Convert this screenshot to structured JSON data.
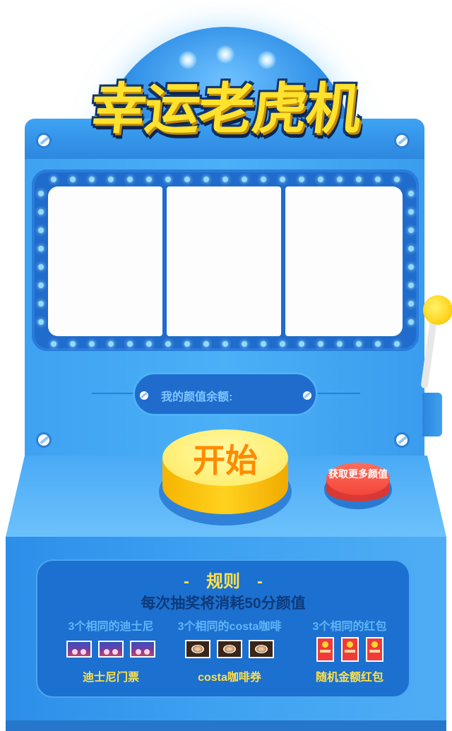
{
  "title": "幸运老虎机",
  "balance": {
    "label": "我的颜值余额:",
    "value": ""
  },
  "buttons": {
    "start": "开始",
    "more": "获取更多颜值"
  },
  "rules": {
    "title": "-　规则　-",
    "description": "每次抽奖将消耗50分颜值",
    "prizes": [
      {
        "condition": "3个相同的迪士尼",
        "reward": "迪士尼门票",
        "icon": "disney-ticket-icon"
      },
      {
        "condition": "3个相同的costa咖啡",
        "reward": "costa咖啡券",
        "icon": "coffee-icon"
      },
      {
        "condition": "3个相同的红包",
        "reward": "随机金额红包",
        "icon": "red-packet-icon"
      }
    ]
  },
  "colors": {
    "cabinet": "#3ea2f2",
    "frame": "#1f6ccc",
    "title": "#ffe22d",
    "start": "#ffd21f",
    "more": "#f3473c",
    "accent_text": "#ffe14a"
  }
}
